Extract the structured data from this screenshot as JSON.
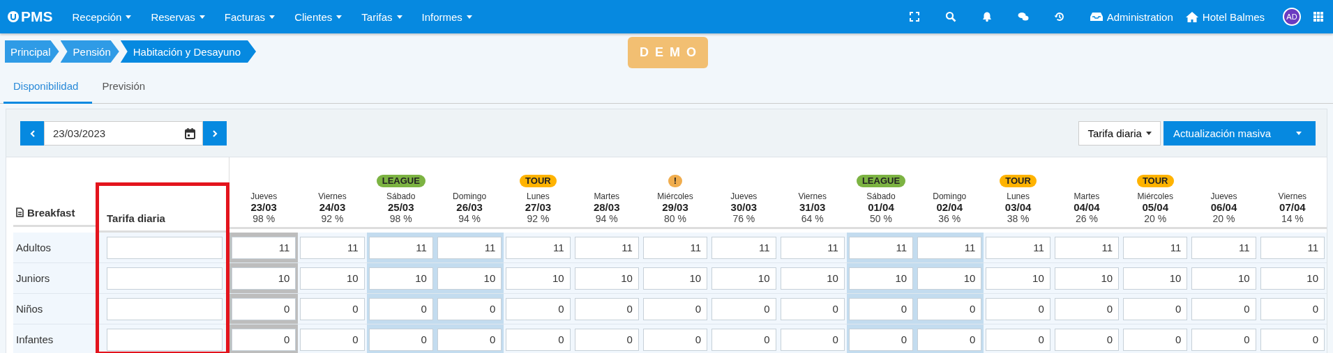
{
  "navbar": {
    "logo": "PMS",
    "menus": [
      {
        "label": "Recepción"
      },
      {
        "label": "Reservas"
      },
      {
        "label": "Facturas"
      },
      {
        "label": "Clientes"
      },
      {
        "label": "Tarifas"
      },
      {
        "label": "Informes"
      }
    ],
    "admin": "Administration",
    "hotel": "Hotel Balmes",
    "avatar": "AD"
  },
  "breadcrumbs": [
    "Principal",
    "Pensión",
    "Habitación y Desayuno"
  ],
  "badge": "DEMO",
  "tabs": [
    {
      "label": "Disponibilidad",
      "selected": true
    },
    {
      "label": "Previsión",
      "selected": false
    }
  ],
  "toolbar": {
    "date": "23/03/2023",
    "rate_menu": "Tarifa diaria",
    "bulk_button": "Actualización masiva"
  },
  "table": {
    "title": "Breakfast",
    "rate_column": {
      "label": "Tarifa diaria",
      "highlighted": true
    },
    "days": [
      {
        "weekday": "Jueves",
        "date": "23/03",
        "occupancy": "98 %",
        "kind": "today"
      },
      {
        "weekday": "Viernes",
        "date": "24/03",
        "occupancy": "92 %",
        "kind": "normal"
      },
      {
        "weekday": "Sábado",
        "date": "25/03",
        "occupancy": "98 %",
        "kind": "weekend",
        "tag": {
          "label": "LEAGUE",
          "color": "#7cb342"
        }
      },
      {
        "weekday": "Domingo",
        "date": "26/03",
        "occupancy": "94 %",
        "kind": "weekend"
      },
      {
        "weekday": "Lunes",
        "date": "27/03",
        "occupancy": "92 %",
        "kind": "normal",
        "tag": {
          "label": "TOUR",
          "color": "#ffb300"
        }
      },
      {
        "weekday": "Martes",
        "date": "28/03",
        "occupancy": "94 %",
        "kind": "normal"
      },
      {
        "weekday": "Miércoles",
        "date": "29/03",
        "occupancy": "80 %",
        "kind": "normal",
        "tag": {
          "label": "!",
          "color": "#f0ad4e"
        }
      },
      {
        "weekday": "Jueves",
        "date": "30/03",
        "occupancy": "76 %",
        "kind": "normal"
      },
      {
        "weekday": "Viernes",
        "date": "31/03",
        "occupancy": "64 %",
        "kind": "normal"
      },
      {
        "weekday": "Sábado",
        "date": "01/04",
        "occupancy": "50 %",
        "kind": "weekend",
        "tag": {
          "label": "LEAGUE",
          "color": "#7cb342"
        }
      },
      {
        "weekday": "Domingo",
        "date": "02/04",
        "occupancy": "36 %",
        "kind": "weekend"
      },
      {
        "weekday": "Lunes",
        "date": "03/04",
        "occupancy": "38 %",
        "kind": "normal",
        "tag": {
          "label": "TOUR",
          "color": "#ffb300"
        }
      },
      {
        "weekday": "Martes",
        "date": "04/04",
        "occupancy": "26 %",
        "kind": "normal"
      },
      {
        "weekday": "Miércoles",
        "date": "05/04",
        "occupancy": "20 %",
        "kind": "normal",
        "tag": {
          "label": "TOUR",
          "color": "#ffb300"
        }
      },
      {
        "weekday": "Jueves",
        "date": "06/04",
        "occupancy": "20 %",
        "kind": "normal"
      },
      {
        "weekday": "Viernes",
        "date": "07/04",
        "occupancy": "14 %",
        "kind": "normal"
      }
    ],
    "rows": [
      {
        "label": "Adultos",
        "values": [
          "11",
          "11",
          "11",
          "11",
          "11",
          "11",
          "11",
          "11",
          "11",
          "11",
          "11",
          "11",
          "11",
          "11",
          "11",
          "11"
        ]
      },
      {
        "label": "Juniors",
        "values": [
          "10",
          "10",
          "10",
          "10",
          "10",
          "10",
          "10",
          "10",
          "10",
          "10",
          "10",
          "10",
          "10",
          "10",
          "10",
          "10"
        ]
      },
      {
        "label": "Niños",
        "values": [
          "0",
          "0",
          "0",
          "0",
          "0",
          "0",
          "0",
          "0",
          "0",
          "0",
          "0",
          "0",
          "0",
          "0",
          "0",
          "0"
        ]
      },
      {
        "label": "Infantes",
        "values": [
          "0",
          "0",
          "0",
          "0",
          "0",
          "0",
          "0",
          "0",
          "0",
          "0",
          "0",
          "0",
          "0",
          "0",
          "0",
          "0"
        ]
      }
    ]
  }
}
